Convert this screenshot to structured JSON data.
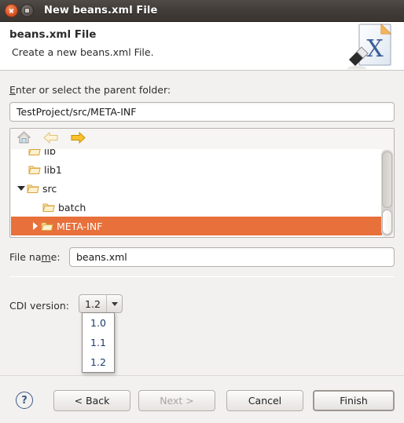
{
  "window": {
    "title": "New beans.xml File",
    "close_icon": "close-icon",
    "maximize_icon": "maximize-icon"
  },
  "header": {
    "title": "beans.xml File",
    "subtitle": "Create a new beans.xml File.",
    "icon": "xml-file-icon"
  },
  "form": {
    "parent_label_prefix": "",
    "parent_label_mnemonic": "E",
    "parent_label_rest": "nter or select the parent folder:",
    "parent_value": "TestProject/src/META-INF",
    "file_label_a": "File na",
    "file_label_mnemonic": "m",
    "file_label_b": "e:",
    "file_value": "beans.xml",
    "cdi_label": "CDI version:",
    "cdi_value": "1.2",
    "cdi_options": [
      "1.0",
      "1.1",
      "1.2"
    ]
  },
  "tree": {
    "toolbar": [
      {
        "name": "home-icon",
        "state": "enabled"
      },
      {
        "name": "back-arrow-icon",
        "state": "disabled"
      },
      {
        "name": "forward-arrow-icon",
        "state": "enabled"
      }
    ],
    "rows": [
      {
        "label": "lib",
        "indent": 1,
        "twisty": "none",
        "selected": false,
        "clipped": true
      },
      {
        "label": "lib1",
        "indent": 1,
        "twisty": "none",
        "selected": false,
        "clipped": false
      },
      {
        "label": "src",
        "indent": 0,
        "twisty": "down",
        "selected": false,
        "clipped": false
      },
      {
        "label": "batch",
        "indent": 2,
        "twisty": "none",
        "selected": false,
        "clipped": false
      },
      {
        "label": "META-INF",
        "indent": 1,
        "twisty": "right",
        "selected": true,
        "clipped": false
      }
    ]
  },
  "buttons": {
    "help": "?",
    "back": "< Back",
    "next": "Next >",
    "cancel": "Cancel",
    "finish": "Finish"
  },
  "colors": {
    "selection": "#e8703a",
    "titlebar": "#413c38",
    "close_button": "#e05a28",
    "popup_text": "#1b3c6e"
  }
}
